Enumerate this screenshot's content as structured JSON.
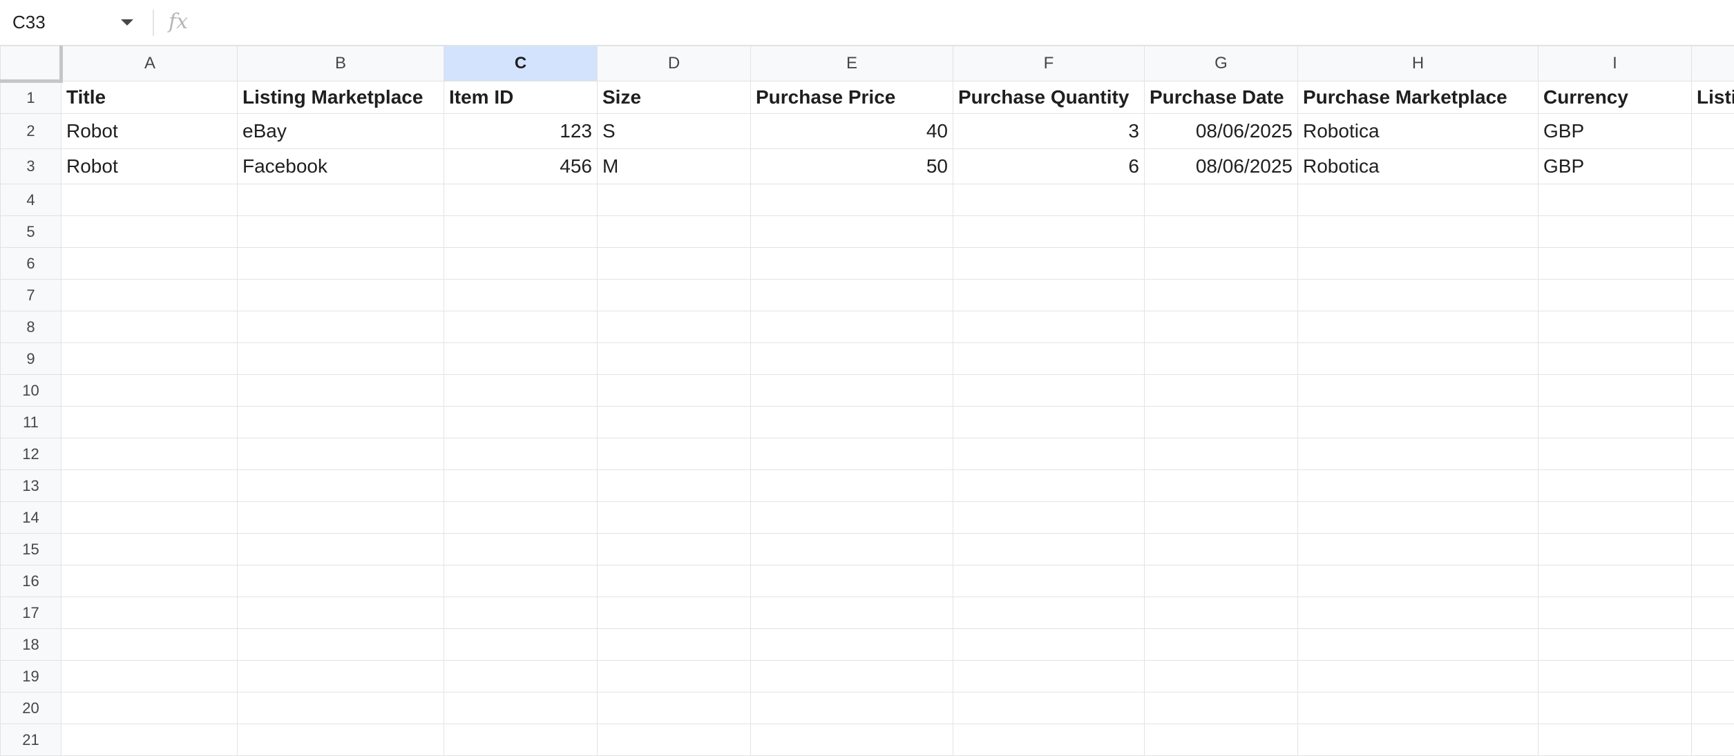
{
  "formula_bar": {
    "cell_reference": "C33",
    "fx_label": "fx",
    "formula_value": ""
  },
  "columns": [
    "A",
    "B",
    "C",
    "D",
    "E",
    "F",
    "G",
    "H",
    "I",
    ""
  ],
  "selected_column": "C",
  "header_row": [
    "Title",
    "Listing Marketplace",
    "Item ID",
    "Size",
    "Purchase Price",
    "Purchase Quantity",
    "Purchase Date",
    "Purchase Marketplace",
    "Currency",
    "Listi"
  ],
  "data_rows": [
    [
      "Robot",
      "eBay",
      "123",
      "S",
      "40",
      "3",
      "08/06/2025",
      "Robotica",
      "GBP",
      ""
    ],
    [
      "Robot",
      "Facebook",
      "456",
      "M",
      "50",
      "6",
      "08/06/2025",
      "Robotica",
      "GBP",
      ""
    ]
  ],
  "row_numbers": [
    "1",
    "2",
    "3",
    "4",
    "5",
    "6",
    "7",
    "8",
    "9",
    "10",
    "11",
    "12",
    "13",
    "14",
    "15",
    "16",
    "17",
    "18",
    "19",
    "20",
    "21"
  ]
}
